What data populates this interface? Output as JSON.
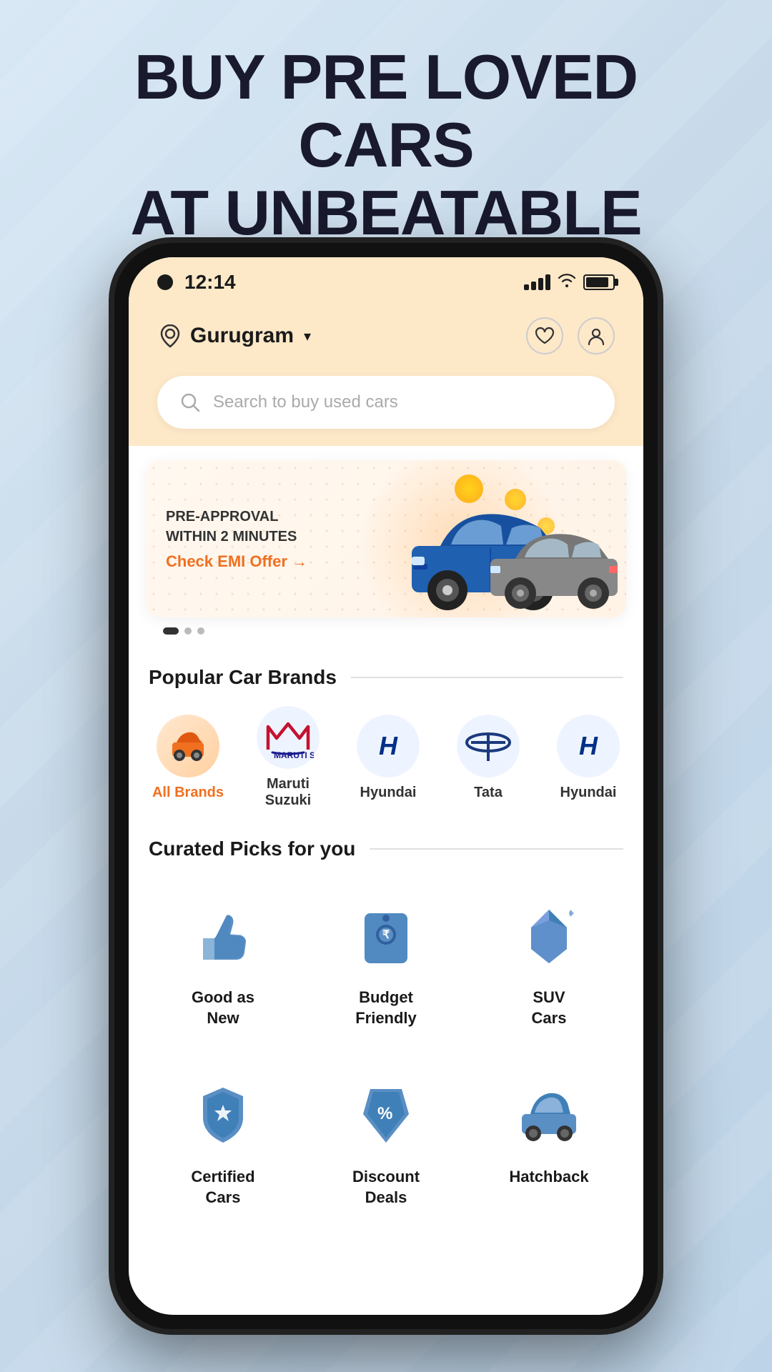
{
  "page": {
    "bg_title_line1": "BUY PRE LOVED CARS",
    "bg_title_line2": "AT UNBEATABLE PRICES"
  },
  "status_bar": {
    "time": "12:14",
    "signal": "signal-bars-icon",
    "wifi": "wifi-icon",
    "battery": "battery-icon"
  },
  "header": {
    "location": "Gurugram",
    "location_icon": "location-pin-icon",
    "dropdown_icon": "chevron-down-icon",
    "favorite_icon": "heart-icon",
    "profile_icon": "person-icon"
  },
  "search": {
    "placeholder": "Search to buy used cars"
  },
  "banner": {
    "subtitle": "PRE-APPROVAL\nWITHIN 2 MINUTES",
    "cta_text": "Check EMI Offer →",
    "dots": [
      "active",
      "inactive",
      "inactive"
    ]
  },
  "popular_brands": {
    "section_title": "Popular Car Brands",
    "brands": [
      {
        "name": "All Brands",
        "type": "all"
      },
      {
        "name": "Maruti\nSuzuki",
        "type": "maruti"
      },
      {
        "name": "Hyundai",
        "type": "hyundai"
      },
      {
        "name": "Tata",
        "type": "tata"
      },
      {
        "name": "Hyundai",
        "type": "hyundai2"
      }
    ]
  },
  "curated_picks": {
    "section_title": "Curated Picks for you",
    "items": [
      {
        "label": "Good as\nNew",
        "icon": "thumbsup-icon"
      },
      {
        "label": "Budget\nFriendly",
        "icon": "wallet-icon"
      },
      {
        "label": "SUV\nCars",
        "icon": "diamond-icon"
      },
      {
        "label": "Certified\nCars",
        "icon": "shield-icon"
      },
      {
        "label": "Discount\nDeals",
        "icon": "tag-icon"
      },
      {
        "label": "Hatchback",
        "icon": "car-icon"
      }
    ]
  }
}
